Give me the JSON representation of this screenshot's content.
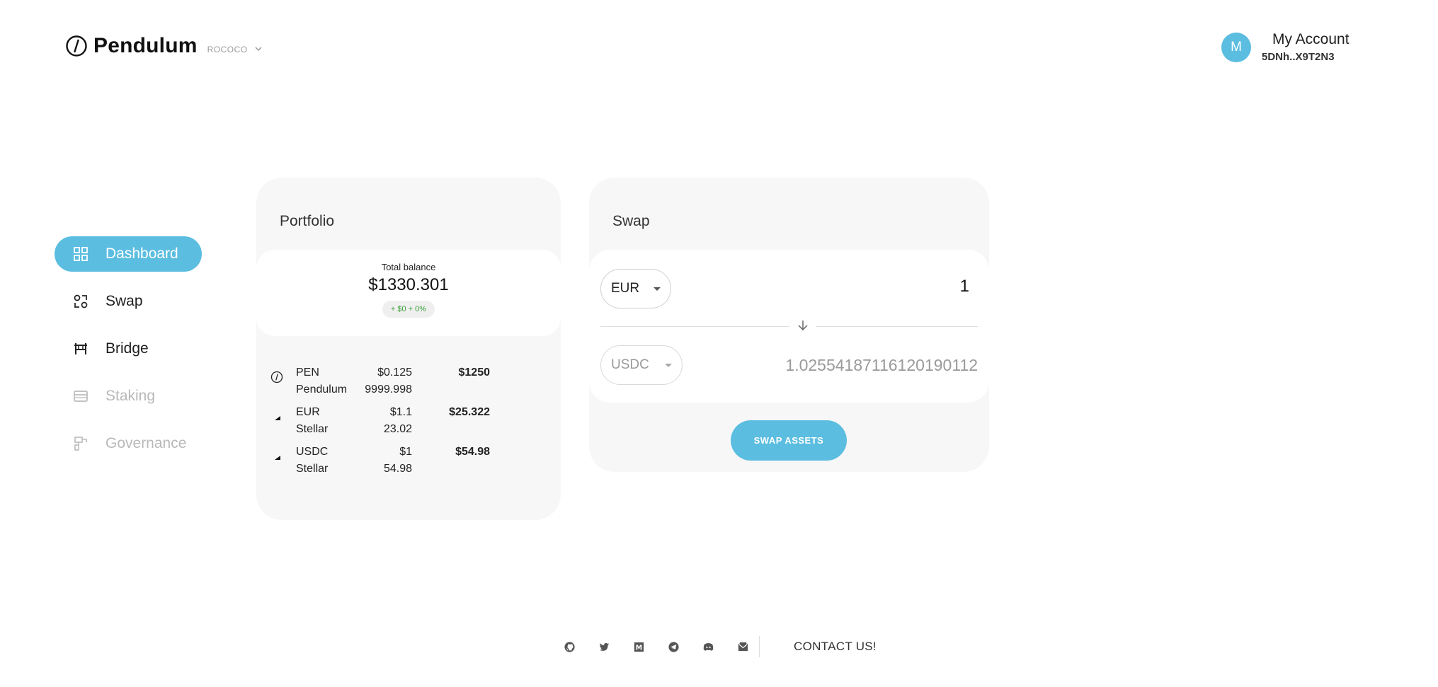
{
  "header": {
    "brand": "Pendulum",
    "network": "ROCOCO",
    "logo_icon": "pendulum-logo-icon",
    "account": {
      "avatar_letter": "M",
      "title": "My Account",
      "address": "5DNh..X9T2N3"
    }
  },
  "sidebar": {
    "items": [
      {
        "label": "Dashboard",
        "icon": "dashboard-grid-icon",
        "state": "active"
      },
      {
        "label": "Swap",
        "icon": "swap-icon",
        "state": "normal"
      },
      {
        "label": "Bridge",
        "icon": "bridge-icon",
        "state": "normal"
      },
      {
        "label": "Staking",
        "icon": "staking-icon",
        "state": "disabled"
      },
      {
        "label": "Governance",
        "icon": "governance-icon",
        "state": "disabled"
      }
    ]
  },
  "portfolio": {
    "title": "Portfolio",
    "total_label": "Total balance",
    "total_value": "$1330.301",
    "change": "+ $0 + 0%",
    "assets": [
      {
        "symbol": "PEN",
        "chain": "Pendulum",
        "price": "$0.125",
        "amount": "9999.998",
        "value": "$1250",
        "icon": "pendulum-token-icon"
      },
      {
        "symbol": "EUR",
        "chain": "Stellar",
        "price": "$1.1",
        "amount": "23.02",
        "value": "$25.322",
        "icon": "stellar-token-icon"
      },
      {
        "symbol": "USDC",
        "chain": "Stellar",
        "price": "$1",
        "amount": "54.98",
        "value": "$54.98",
        "icon": "stellar-token-icon"
      }
    ]
  },
  "swap": {
    "title": "Swap",
    "from_token": "EUR",
    "from_amount": "1",
    "to_token": "USDC",
    "to_amount": "1.02554187116120190112",
    "button_label": "SWAP ASSETS"
  },
  "footer": {
    "icons": [
      "github-icon",
      "twitter-icon",
      "medium-icon",
      "telegram-icon",
      "discord-icon",
      "email-icon"
    ],
    "contact": "CONTACT US!"
  },
  "colors": {
    "accent": "#5bbde0",
    "card_bg": "#f7f7f7",
    "positive": "#3aa13a",
    "disabled": "#b9b9b9"
  }
}
